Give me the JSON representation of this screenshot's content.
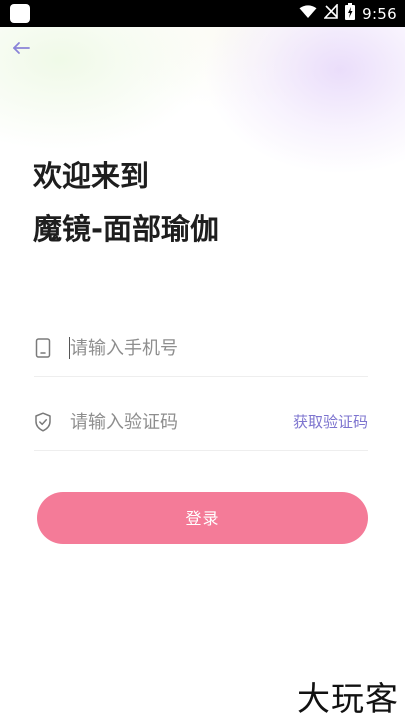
{
  "status_bar": {
    "time": "9:56"
  },
  "header": {
    "back_icon": "arrow-left-icon"
  },
  "welcome": {
    "line1": "欢迎来到",
    "line2": "魔镜-面部瑜伽"
  },
  "phone_field": {
    "placeholder": "请输入手机号",
    "value": "",
    "icon": "phone-icon"
  },
  "code_field": {
    "placeholder": "请输入验证码",
    "value": "",
    "icon": "shield-icon",
    "get_code_label": "获取验证码"
  },
  "login_button": {
    "label": "登录"
  },
  "watermark": {
    "text": "大玩客"
  },
  "colors": {
    "accent": "#f47b98",
    "link": "#7d74cf",
    "back_arrow": "#8a84d8"
  }
}
